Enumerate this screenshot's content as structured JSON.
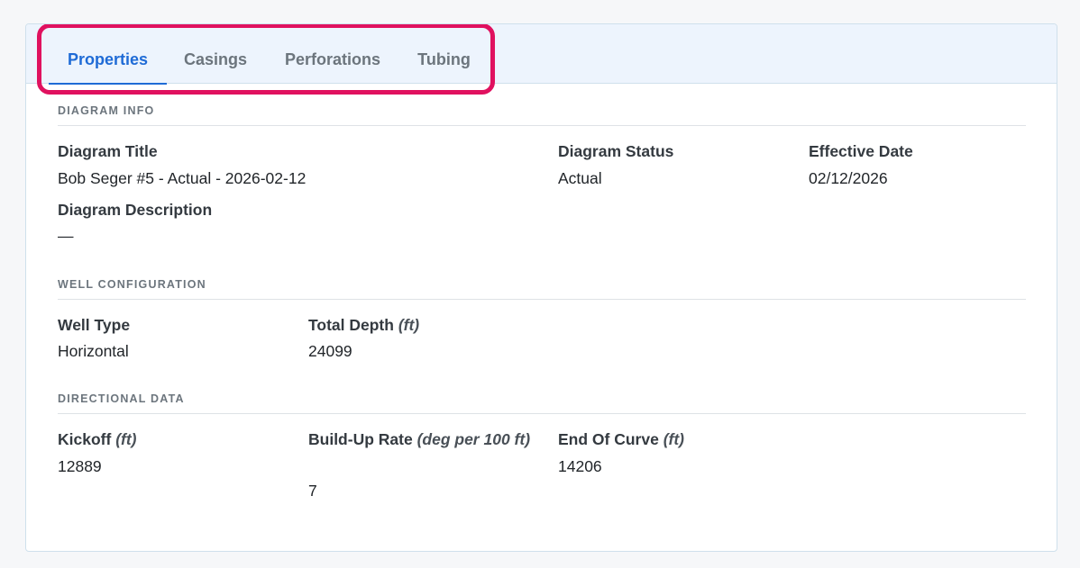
{
  "tabs": [
    {
      "label": "Properties",
      "active": true
    },
    {
      "label": "Casings",
      "active": false
    },
    {
      "label": "Perforations",
      "active": false
    },
    {
      "label": "Tubing",
      "active": false
    }
  ],
  "colors": {
    "accent": "#1f6bd6",
    "highlight": "#e0115f",
    "tabbar_bg": "#edf4fd"
  },
  "diagram_info": {
    "section_title": "DIAGRAM INFO",
    "title_label": "Diagram Title",
    "title_value": "Bob Seger #5 - Actual - 2026-02-12",
    "status_label": "Diagram Status",
    "status_value": "Actual",
    "date_label": "Effective Date",
    "date_value": "02/12/2026",
    "description_label": "Diagram Description",
    "description_value": "—"
  },
  "well_configuration": {
    "section_title": "WELL CONFIGURATION",
    "type_label": "Well Type",
    "type_value": "Horizontal",
    "depth_label": "Total Depth",
    "depth_unit": "(ft)",
    "depth_value": "24099"
  },
  "directional_data": {
    "section_title": "DIRECTIONAL DATA",
    "kickoff_label": "Kickoff",
    "kickoff_unit": "(ft)",
    "kickoff_value": "12889",
    "buildup_label": "Build-Up Rate",
    "buildup_unit": "(deg per 100 ft)",
    "buildup_value": "7",
    "eoc_label": "End Of Curve",
    "eoc_unit": "(ft)",
    "eoc_value": "14206"
  }
}
